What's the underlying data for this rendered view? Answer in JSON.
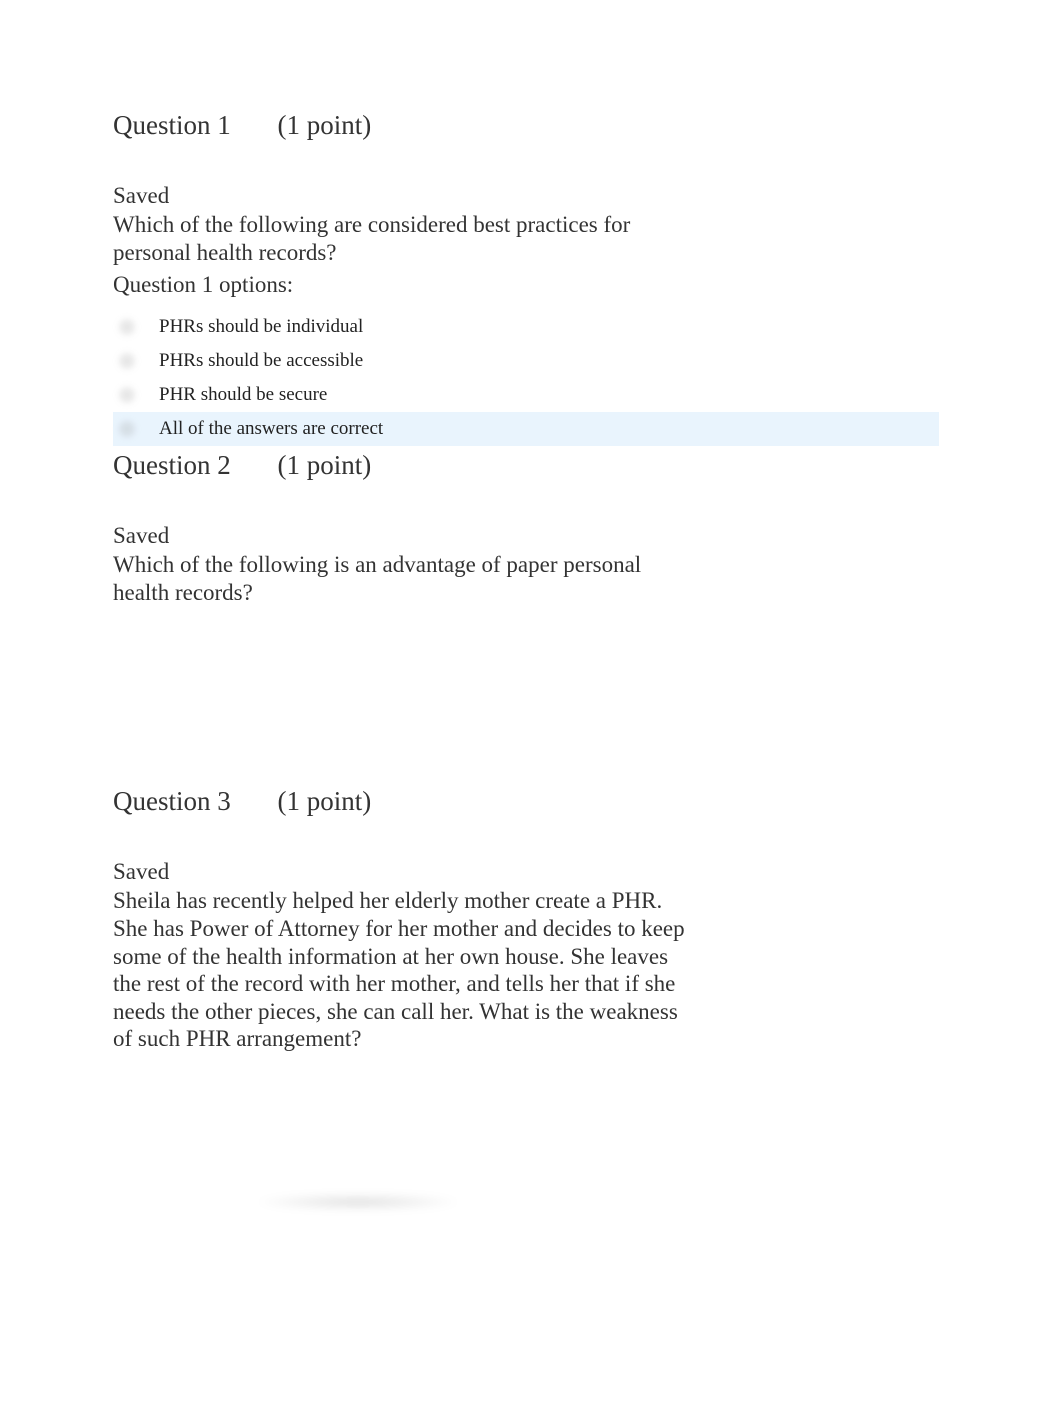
{
  "q1": {
    "heading_number": "Question 1",
    "heading_points": "(1 point)",
    "status": "Saved",
    "prompt": "Which of the following are considered best practices for personal health records?",
    "options_label": "Question 1 options:",
    "options": [
      {
        "text": "PHRs should be individual",
        "highlight": false
      },
      {
        "text": "PHRs should be accessible",
        "highlight": false
      },
      {
        "text": "PHR should be secure",
        "highlight": false
      },
      {
        "text": "All of the answers are correct",
        "highlight": true
      }
    ]
  },
  "q2": {
    "heading_number": "Question 2",
    "heading_points": "(1 point)",
    "status": "Saved",
    "prompt": "Which of the following is an advantage of paper personal health records?"
  },
  "q3": {
    "heading_number": "Question 3",
    "heading_points": "(1 point)",
    "status": "Saved",
    "prompt": "Sheila has recently helped her elderly mother create a PHR. She has Power of Attorney for her mother and decides to keep some of the health information at her own house. She leaves the rest of the record with her mother, and tells her that if she needs the other pieces, she can call her. What is the weakness of such PHR arrangement?"
  }
}
